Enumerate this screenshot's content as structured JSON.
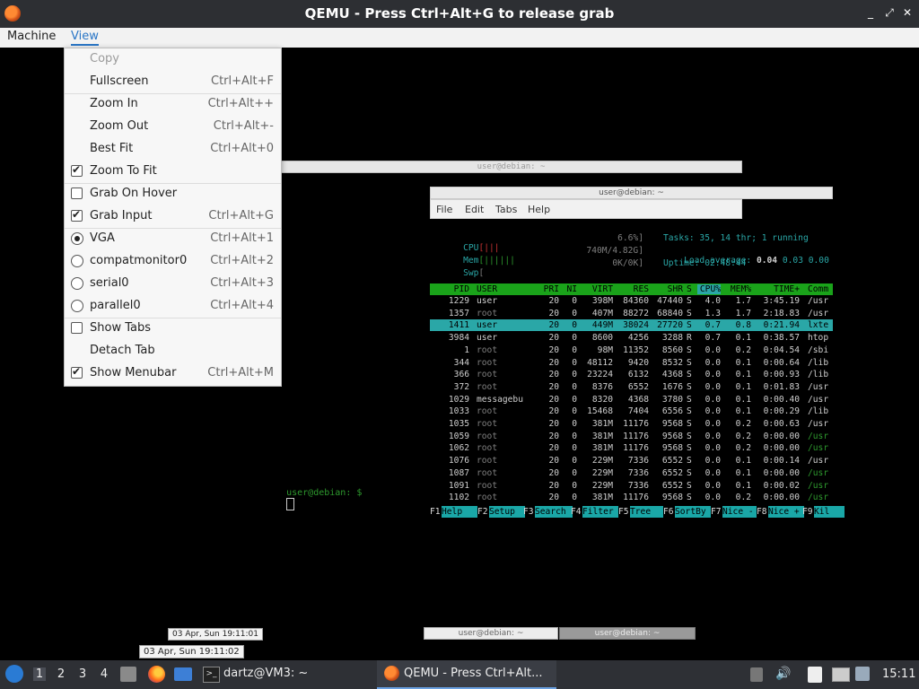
{
  "window": {
    "title": "QEMU - Press Ctrl+Alt+G to release grab",
    "controls": [
      "_",
      "⤢",
      "✕"
    ]
  },
  "menubar": {
    "items": [
      {
        "label": "Machine"
      },
      {
        "label": "View"
      }
    ]
  },
  "view_menu": {
    "items": [
      {
        "label": "Copy",
        "shortcut": "",
        "disabled": true,
        "check": "none"
      },
      {
        "label": "Fullscreen",
        "shortcut": "Ctrl+Alt+F",
        "check": "none"
      },
      {
        "label": "Zoom In",
        "shortcut": "Ctrl+Alt++",
        "check": "none"
      },
      {
        "label": "Zoom Out",
        "shortcut": "Ctrl+Alt+-",
        "check": "none"
      },
      {
        "label": "Best Fit",
        "shortcut": "Ctrl+Alt+0",
        "check": "none"
      },
      {
        "label": "Zoom To Fit",
        "shortcut": "",
        "check": "checked"
      },
      {
        "label": "Grab On Hover",
        "shortcut": "",
        "check": "unchecked"
      },
      {
        "label": "Grab Input",
        "shortcut": "Ctrl+Alt+G",
        "check": "checked"
      },
      {
        "label": "VGA",
        "shortcut": "Ctrl+Alt+1",
        "check": "radio-on"
      },
      {
        "label": "compatmonitor0",
        "shortcut": "Ctrl+Alt+2",
        "check": "radio-off"
      },
      {
        "label": "serial0",
        "shortcut": "Ctrl+Alt+3",
        "check": "radio-off"
      },
      {
        "label": "parallel0",
        "shortcut": "Ctrl+Alt+4",
        "check": "radio-off"
      },
      {
        "label": "Show Tabs",
        "shortcut": "",
        "check": "unchecked"
      },
      {
        "label": "Detach Tab",
        "shortcut": "",
        "check": "none"
      },
      {
        "label": "Show Menubar",
        "shortcut": "Ctrl+Alt+M",
        "check": "checked"
      }
    ]
  },
  "guest": {
    "bg_window_title": "user@debian: ~",
    "terminal": {
      "title": "user@debian: ~",
      "menu": [
        "File",
        "Edit",
        "Tabs",
        "Help"
      ],
      "meters": {
        "cpu_label": "CPU",
        "cpu_bar": "[|||",
        "cpu_value": "6.6%]",
        "mem_label": "Mem",
        "mem_bar": "[||||||",
        "mem_value": "740M/4.82G]",
        "swp_label": "Swp",
        "swp_bar": "[",
        "swp_value": "0K/0K]"
      },
      "stats": {
        "tasks": "Tasks: 35, 14 thr; 1 running",
        "load_label": "Load average:",
        "load_1": "0.04",
        "load_rest": "0.03 0.00",
        "uptime": "Uptime: 02:48:44"
      },
      "columns": [
        "PID",
        "USER",
        "PRI",
        "NI",
        "VIRT",
        "RES",
        "SHR",
        "S",
        "CPU%",
        "MEM%",
        "TIME+",
        "Comm"
      ],
      "rows": [
        [
          "1229",
          "user",
          "20",
          "0",
          "398M",
          "84360",
          "47440",
          "S",
          "4.0",
          "1.7",
          "3:45.19",
          "/usr"
        ],
        [
          "1357",
          "root",
          "20",
          "0",
          "407M",
          "88272",
          "68840",
          "S",
          "1.3",
          "1.7",
          "2:18.83",
          "/usr"
        ],
        [
          "1411",
          "user",
          "20",
          "0",
          "449M",
          "38024",
          "27720",
          "S",
          "0.7",
          "0.8",
          "0:21.94",
          "lxte"
        ],
        [
          "3984",
          "user",
          "20",
          "0",
          "8600",
          "4256",
          "3288",
          "R",
          "0.7",
          "0.1",
          "0:38.57",
          "htop"
        ],
        [
          "1",
          "root",
          "20",
          "0",
          "98M",
          "11352",
          "8560",
          "S",
          "0.0",
          "0.2",
          "0:04.54",
          "/sbi"
        ],
        [
          "344",
          "root",
          "20",
          "0",
          "48112",
          "9420",
          "8532",
          "S",
          "0.0",
          "0.1",
          "0:00.64",
          "/lib"
        ],
        [
          "366",
          "root",
          "20",
          "0",
          "23224",
          "6132",
          "4368",
          "S",
          "0.0",
          "0.1",
          "0:00.93",
          "/lib"
        ],
        [
          "372",
          "root",
          "20",
          "0",
          "8376",
          "6552",
          "1676",
          "S",
          "0.0",
          "0.1",
          "0:01.83",
          "/usr"
        ],
        [
          "1029",
          "messagebu",
          "20",
          "0",
          "8320",
          "4368",
          "3780",
          "S",
          "0.0",
          "0.1",
          "0:00.40",
          "/usr"
        ],
        [
          "1033",
          "root",
          "20",
          "0",
          "15468",
          "7404",
          "6556",
          "S",
          "0.0",
          "0.1",
          "0:00.29",
          "/lib"
        ],
        [
          "1035",
          "root",
          "20",
          "0",
          "381M",
          "11176",
          "9568",
          "S",
          "0.0",
          "0.2",
          "0:00.63",
          "/usr"
        ],
        [
          "1059",
          "root",
          "20",
          "0",
          "381M",
          "11176",
          "9568",
          "S",
          "0.0",
          "0.2",
          "0:00.00",
          "/usr"
        ],
        [
          "1062",
          "root",
          "20",
          "0",
          "381M",
          "11176",
          "9568",
          "S",
          "0.0",
          "0.2",
          "0:00.00",
          "/usr"
        ],
        [
          "1076",
          "root",
          "20",
          "0",
          "229M",
          "7336",
          "6552",
          "S",
          "0.0",
          "0.1",
          "0:00.14",
          "/usr"
        ],
        [
          "1087",
          "root",
          "20",
          "0",
          "229M",
          "7336",
          "6552",
          "S",
          "0.0",
          "0.1",
          "0:00.00",
          "/usr"
        ],
        [
          "1091",
          "root",
          "20",
          "0",
          "229M",
          "7336",
          "6552",
          "S",
          "0.0",
          "0.1",
          "0:00.02",
          "/usr"
        ],
        [
          "1102",
          "root",
          "20",
          "0",
          "381M",
          "11176",
          "9568",
          "S",
          "0.0",
          "0.2",
          "0:00.00",
          "/usr"
        ]
      ],
      "fkeys": [
        {
          "num": "F1",
          "label": "Help"
        },
        {
          "num": "F2",
          "label": "Setup"
        },
        {
          "num": "F3",
          "label": "Search"
        },
        {
          "num": "F4",
          "label": "Filter"
        },
        {
          "num": "F5",
          "label": "Tree"
        },
        {
          "num": "F6",
          "label": "SortBy"
        },
        {
          "num": "F7",
          "label": "Nice -"
        },
        {
          "num": "F8",
          "label": "Nice +"
        },
        {
          "num": "F9",
          "label": "Kil"
        }
      ]
    },
    "prompt": "user@debian: $",
    "tooltip_1": "03 Apr, Sun 19:11:01",
    "bottom_tasks": [
      "user@debian: ~",
      "user@debian: ~"
    ]
  },
  "host_tooltip": "03 Apr, Sun 19:11:02",
  "taskbar": {
    "workspaces": [
      "1",
      "2",
      "3",
      "4"
    ],
    "apps": [
      {
        "label": "dartz@VM3: ~"
      },
      {
        "label": "QEMU - Press Ctrl+Alt..."
      }
    ],
    "clock": "15:11"
  }
}
